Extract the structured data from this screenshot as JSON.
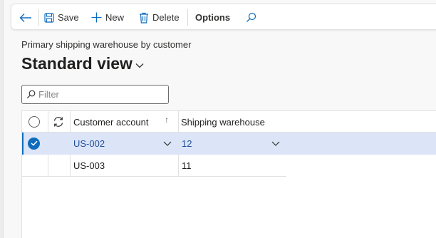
{
  "toolbar": {
    "back_icon": "back-arrow-icon",
    "save_label": "Save",
    "new_label": "New",
    "delete_label": "Delete",
    "options_label": "Options",
    "search_icon": "search-icon"
  },
  "page": {
    "caption": "Primary shipping warehouse by customer",
    "view_title": "Standard view"
  },
  "filter": {
    "placeholder": "Filter"
  },
  "grid": {
    "columns": [
      "Customer account",
      "Shipping warehouse"
    ],
    "sort_indicator": "↑",
    "rows": [
      {
        "customer_account": "US-002",
        "shipping_warehouse": "12",
        "selected": true
      },
      {
        "customer_account": "US-003",
        "shipping_warehouse": "11",
        "selected": false
      }
    ]
  },
  "colors": {
    "accent": "#0f6cbd",
    "selected_row": "#dbe5f7"
  }
}
